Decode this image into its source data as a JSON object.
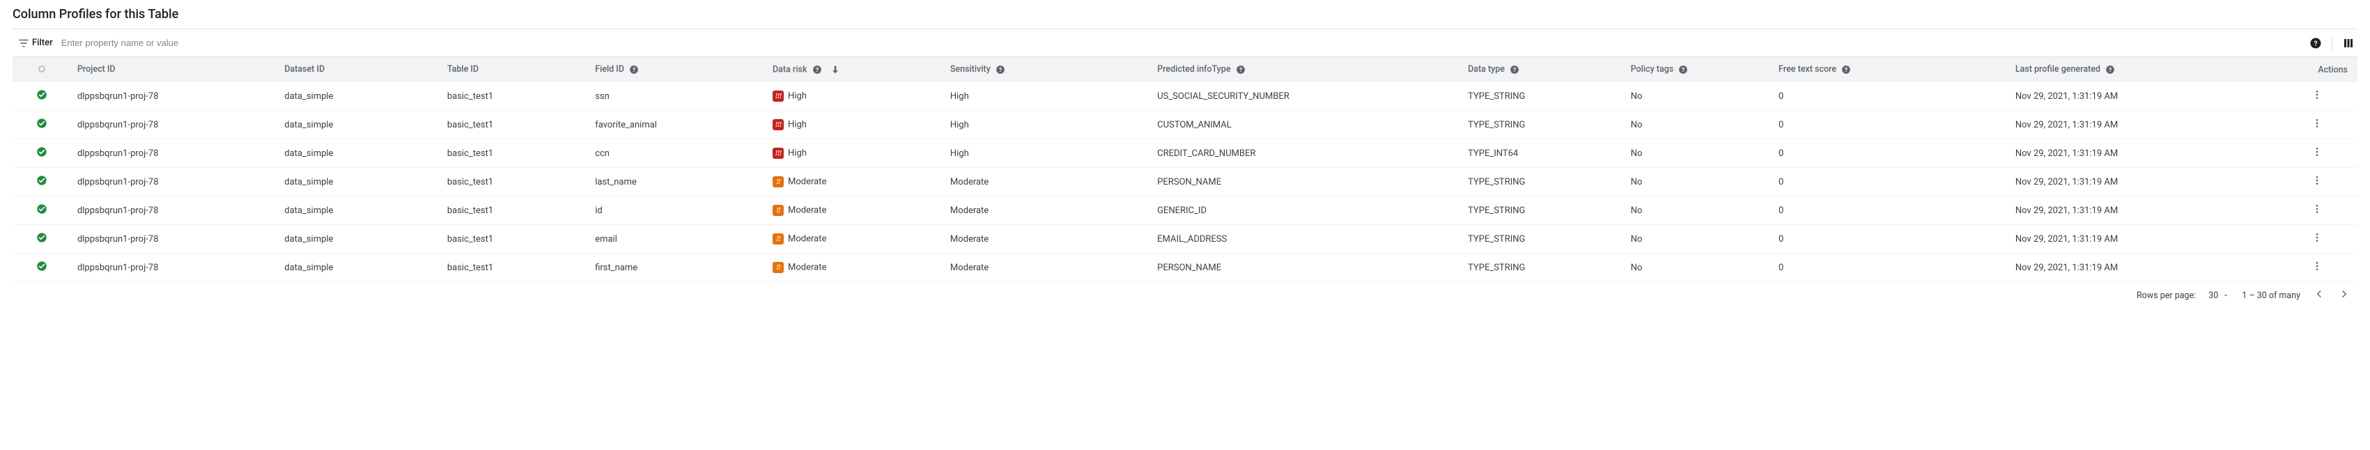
{
  "title": "Column Profiles for this Table",
  "toolbar": {
    "filter_label": "Filter",
    "filter_placeholder": "Enter property name or value"
  },
  "columns": {
    "project": "Project ID",
    "dataset": "Dataset ID",
    "tableid": "Table ID",
    "field": "Field ID",
    "risk": "Data risk",
    "sensitivity": "Sensitivity",
    "infotype": "Predicted infoType",
    "datatype": "Data type",
    "policy": "Policy tags",
    "freetext": "Free text score",
    "lastgen": "Last profile generated",
    "actions": "Actions"
  },
  "risk_levels": {
    "High": "High",
    "Moderate": "Moderate"
  },
  "rows": [
    {
      "project": "dlppsbqrun1-proj-78",
      "dataset": "data_simple",
      "table": "basic_test1",
      "field": "ssn",
      "risk": "High",
      "sensitivity": "High",
      "infotype": "US_SOCIAL_SECURITY_NUMBER",
      "datatype": "TYPE_STRING",
      "policy": "No",
      "freetext": "0",
      "lastgen": "Nov 29, 2021, 1:31:19 AM"
    },
    {
      "project": "dlppsbqrun1-proj-78",
      "dataset": "data_simple",
      "table": "basic_test1",
      "field": "favorite_animal",
      "risk": "High",
      "sensitivity": "High",
      "infotype": "CUSTOM_ANIMAL",
      "datatype": "TYPE_STRING",
      "policy": "No",
      "freetext": "0",
      "lastgen": "Nov 29, 2021, 1:31:19 AM"
    },
    {
      "project": "dlppsbqrun1-proj-78",
      "dataset": "data_simple",
      "table": "basic_test1",
      "field": "ccn",
      "risk": "High",
      "sensitivity": "High",
      "infotype": "CREDIT_CARD_NUMBER",
      "datatype": "TYPE_INT64",
      "policy": "No",
      "freetext": "0",
      "lastgen": "Nov 29, 2021, 1:31:19 AM"
    },
    {
      "project": "dlppsbqrun1-proj-78",
      "dataset": "data_simple",
      "table": "basic_test1",
      "field": "last_name",
      "risk": "Moderate",
      "sensitivity": "Moderate",
      "infotype": "PERSON_NAME",
      "datatype": "TYPE_STRING",
      "policy": "No",
      "freetext": "0",
      "lastgen": "Nov 29, 2021, 1:31:19 AM"
    },
    {
      "project": "dlppsbqrun1-proj-78",
      "dataset": "data_simple",
      "table": "basic_test1",
      "field": "id",
      "risk": "Moderate",
      "sensitivity": "Moderate",
      "infotype": "GENERIC_ID",
      "datatype": "TYPE_STRING",
      "policy": "No",
      "freetext": "0",
      "lastgen": "Nov 29, 2021, 1:31:19 AM"
    },
    {
      "project": "dlppsbqrun1-proj-78",
      "dataset": "data_simple",
      "table": "basic_test1",
      "field": "email",
      "risk": "Moderate",
      "sensitivity": "Moderate",
      "infotype": "EMAIL_ADDRESS",
      "datatype": "TYPE_STRING",
      "policy": "No",
      "freetext": "0",
      "lastgen": "Nov 29, 2021, 1:31:19 AM"
    },
    {
      "project": "dlppsbqrun1-proj-78",
      "dataset": "data_simple",
      "table": "basic_test1",
      "field": "first_name",
      "risk": "Moderate",
      "sensitivity": "Moderate",
      "infotype": "PERSON_NAME",
      "datatype": "TYPE_STRING",
      "policy": "No",
      "freetext": "0",
      "lastgen": "Nov 29, 2021, 1:31:19 AM"
    }
  ],
  "footer": {
    "rows_per_page_label": "Rows per page:",
    "rows_per_page_value": "30",
    "range_label": "1 – 30 of many"
  }
}
